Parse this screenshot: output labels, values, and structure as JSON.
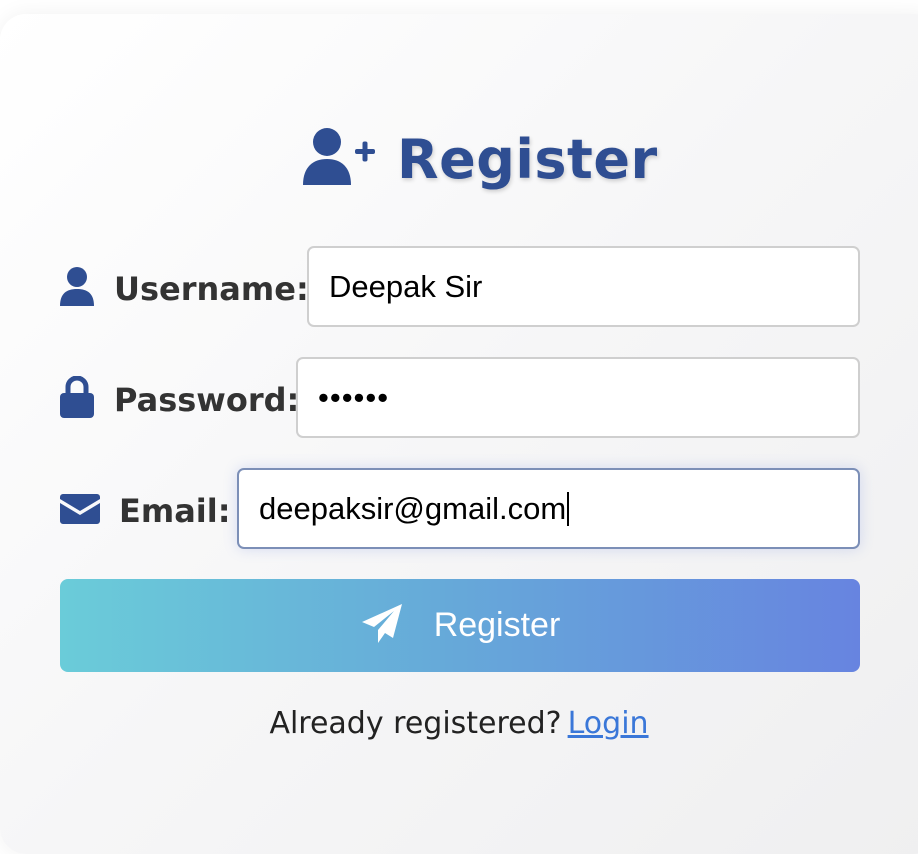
{
  "form": {
    "title": "Register",
    "title_icon": "user-plus-icon",
    "fields": [
      {
        "icon": "user-icon",
        "label": "Username:",
        "value": "Deepak Sir"
      },
      {
        "icon": "lock-icon",
        "label": "Password:",
        "value": "••••••"
      },
      {
        "icon": "envelope-icon",
        "label": "Email:",
        "value": "deepaksir@gmail.com"
      }
    ],
    "submit": {
      "icon": "paper-plane-icon",
      "label": "Register"
    },
    "footer": {
      "text": "Already registered?",
      "link": "Login"
    }
  },
  "colors": {
    "accent": "#2f4e92",
    "button_gradient_start": "#6accd9",
    "button_gradient_end": "#6784e0",
    "link": "#3a77d8"
  }
}
